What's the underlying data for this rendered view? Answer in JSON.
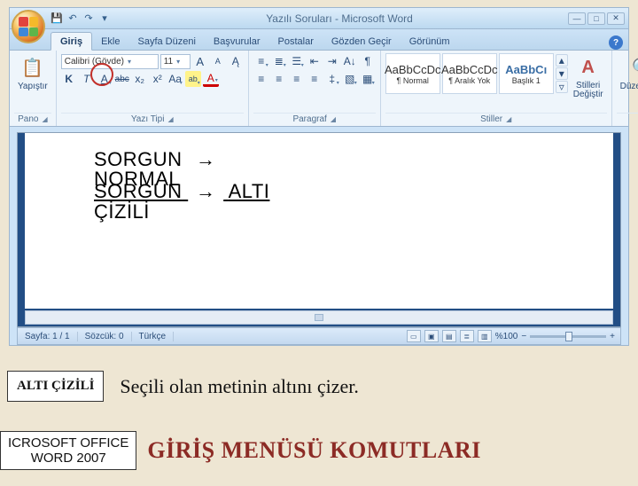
{
  "window": {
    "title": "Yazılı Soruları - Microsoft Word"
  },
  "qat": {
    "save": "💾",
    "undo": "↶",
    "redo": "↷",
    "more": "▾"
  },
  "win": {
    "min": "—",
    "max": "□",
    "close": "✕"
  },
  "tabs": {
    "items": [
      {
        "label": "Giriş",
        "active": true
      },
      {
        "label": "Ekle"
      },
      {
        "label": "Sayfa Düzeni"
      },
      {
        "label": "Başvurular"
      },
      {
        "label": "Postalar"
      },
      {
        "label": "Gözden Geçir"
      },
      {
        "label": "Görünüm"
      }
    ],
    "help": "?"
  },
  "ribbon": {
    "clipboard": {
      "paste": "Yapıştır",
      "label": "Pano"
    },
    "font": {
      "family": "Calibri (Gövde)",
      "size": "11",
      "bold": "K",
      "italic": "T",
      "underline": "A",
      "strike": "abc",
      "sub": "x₂",
      "sup": "x²",
      "case": "Aa",
      "clear": "⌫",
      "highlight": "ab",
      "color": "A",
      "grow": "A",
      "shrink": "A",
      "label": "Yazı Tipi"
    },
    "paragraph": {
      "label": "Paragraf"
    },
    "styles": {
      "items": [
        {
          "preview": "AaBbCcDc",
          "name": "¶ Normal"
        },
        {
          "preview": "AaBbCcDc",
          "name": "¶ Aralık Yok"
        },
        {
          "preview": "AaBbCı",
          "name": "Başlık 1"
        }
      ],
      "change": "Stilleri Değiştir",
      "label": "Stiller"
    },
    "editing": {
      "label": "Düzenleme",
      "find": "🔍"
    }
  },
  "doc": {
    "line1a": "SORGUN",
    "arrow": "→",
    "line2a": "NORMAL",
    "line3a": "SORGUN",
    "line3c": "ALTI",
    "line4": "ÇİZİLİ"
  },
  "status": {
    "page": "Sayfa: 1 / 1",
    "words": "Sözcük: 0",
    "lang": "Türkçe",
    "zoom": "%100",
    "minus": "−",
    "plus": "+"
  },
  "explain": {
    "badge": "ALTI ÇİZİLİ",
    "text": "Seçili olan metinin altını çizer."
  },
  "footer": {
    "badge1": "ICROSOFT OFFICE",
    "badge2": "WORD 2007",
    "title": "GİRİŞ MENÜSÜ KOMUTLARI"
  }
}
